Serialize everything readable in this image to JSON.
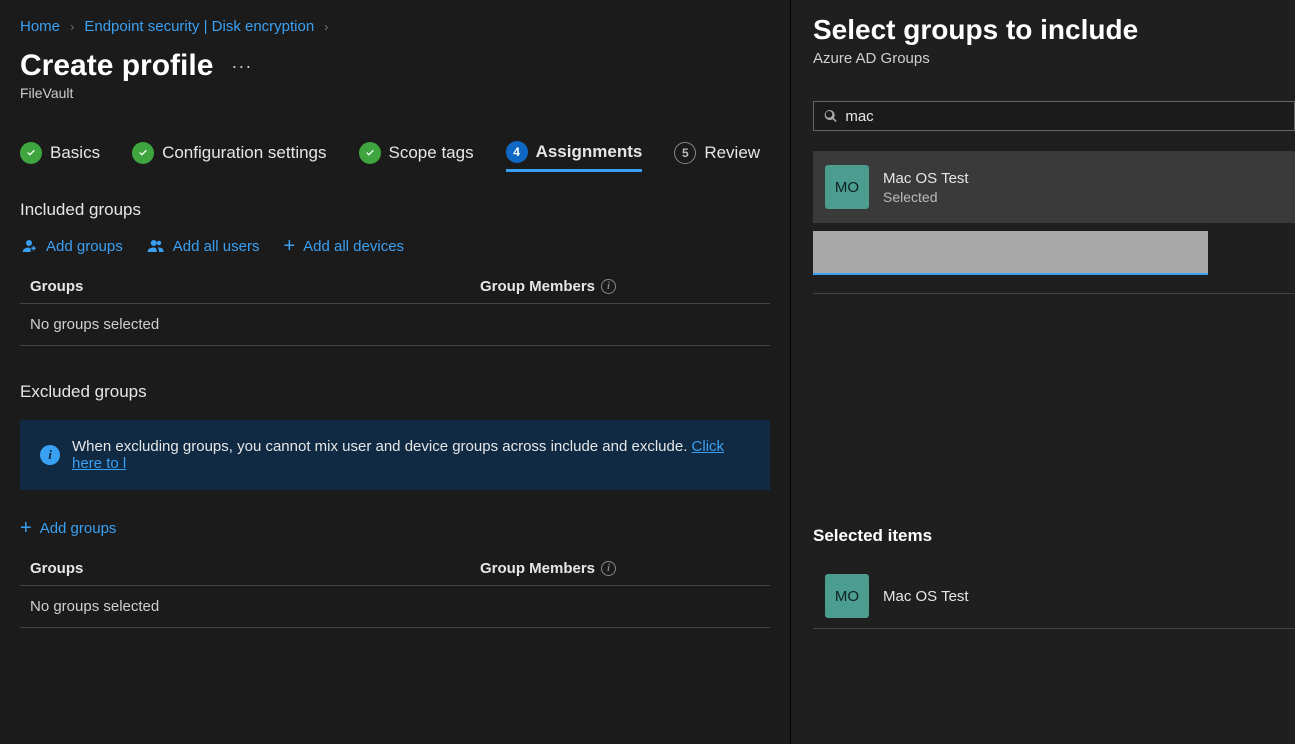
{
  "breadcrumb": {
    "home": "Home",
    "endpoint": "Endpoint security | Disk encryption"
  },
  "pageTitle": "Create profile",
  "subtitle": "FileVault",
  "tabs": {
    "basics": "Basics",
    "config": "Configuration settings",
    "scope": "Scope tags",
    "assignments": "Assignments",
    "assignments_num": "4",
    "review": "Review",
    "review_num": "5"
  },
  "included": {
    "heading": "Included groups",
    "addGroups": "Add groups",
    "addUsers": "Add all users",
    "addDevices": "Add all devices",
    "colGroups": "Groups",
    "colMembers": "Group Members",
    "empty": "No groups selected"
  },
  "excluded": {
    "heading": "Excluded groups",
    "bannerText": "When excluding groups, you cannot mix user and device groups across include and exclude. ",
    "bannerLink": "Click here to l",
    "addGroups": "Add groups",
    "colGroups": "Groups",
    "colMembers": "Group Members",
    "empty": "No groups selected"
  },
  "panel": {
    "title": "Select groups to include",
    "subtitle": "Azure AD Groups",
    "searchValue": "mac",
    "result": {
      "initials": "MO",
      "name": "Mac OS Test",
      "status": "Selected"
    },
    "selectedHeading": "Selected items",
    "selectedItem": {
      "initials": "MO",
      "name": "Mac OS Test"
    }
  }
}
